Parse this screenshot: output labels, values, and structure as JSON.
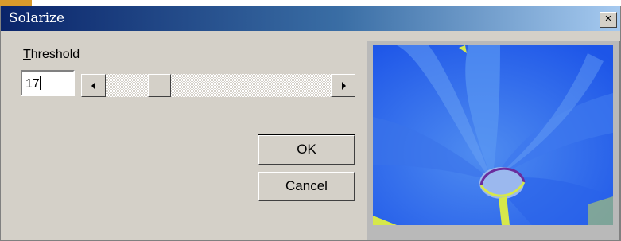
{
  "window": {
    "title": "Solarize",
    "close_symbol": "×"
  },
  "threshold": {
    "label_accel": "T",
    "label_rest": "hreshold",
    "value": "17",
    "min": 0,
    "max": 255
  },
  "slider": {
    "level": 17
  },
  "buttons": {
    "ok": "OK",
    "cancel": "Cancel"
  },
  "preview": {
    "icon": "flower-preview-image",
    "colors": {
      "sky": "#1d55e8",
      "petal": "#4f8cf0",
      "center": "#9bb8ee",
      "stem": "#d6e84a",
      "rim": "#6a2c9c"
    }
  }
}
